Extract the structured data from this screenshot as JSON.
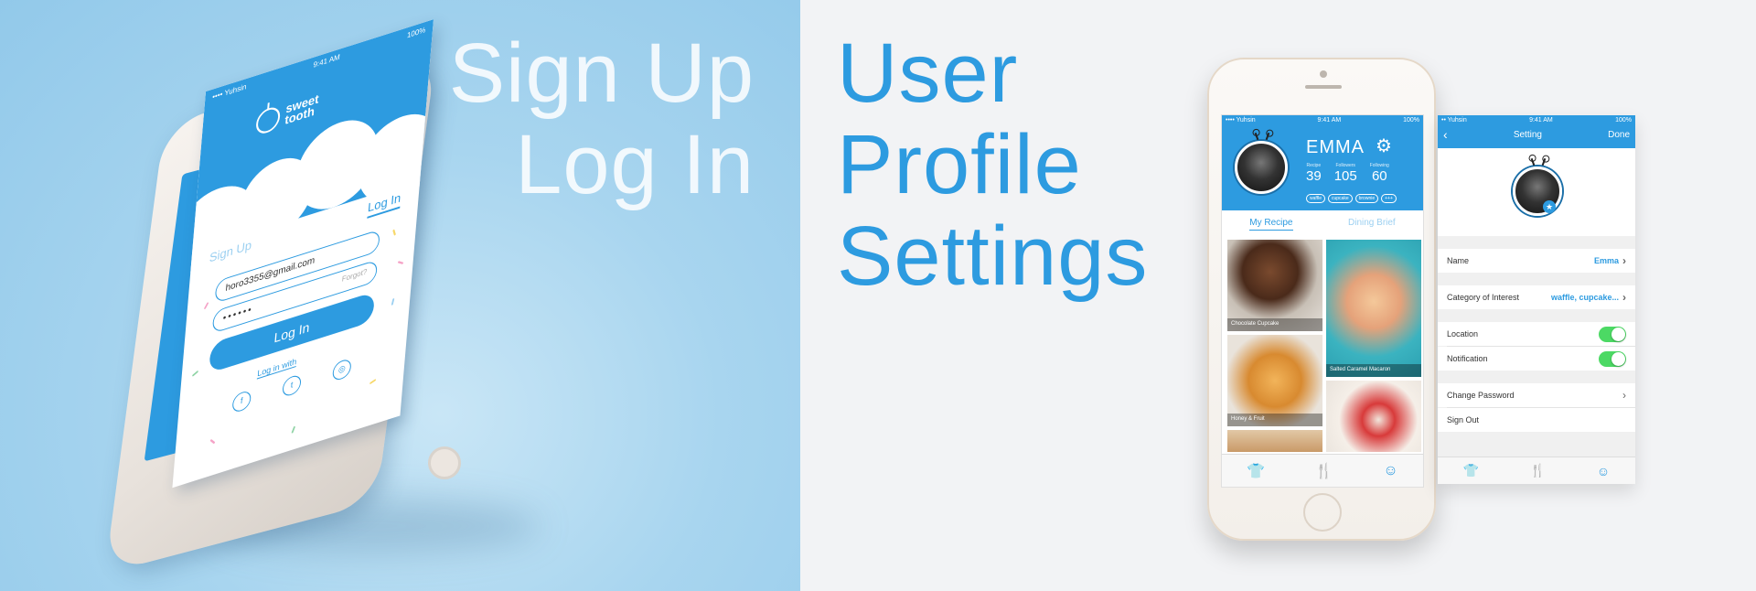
{
  "left_title": [
    "Sign Up",
    "Log In"
  ],
  "right_title": [
    "User",
    "Profile",
    "Settings"
  ],
  "login": {
    "status": {
      "carrier": "•••• Yuhsin",
      "time": "9:41 AM",
      "battery": "100%"
    },
    "logo_text": "sweet tooth",
    "tab_signup": "Sign Up",
    "tab_login": "Log In",
    "email": "horo3355@gmail.com",
    "password": "••••••",
    "forgot": "Forgot?",
    "button": "Log In",
    "login_with": "Log in with",
    "socials": [
      "f",
      "t",
      "◎"
    ]
  },
  "profile": {
    "status": {
      "carrier": "•••• Yuhsin",
      "time": "9:41 AM",
      "battery": "100%"
    },
    "name": "EMMA",
    "stats": [
      {
        "label": "Recipe",
        "value": "39"
      },
      {
        "label": "Followers",
        "value": "105"
      },
      {
        "label": "Following",
        "value": "60"
      }
    ],
    "tags": [
      "waffle",
      "cupcake",
      "brownie",
      "+++"
    ],
    "tabs": [
      "My Recipe",
      "Dining Brief"
    ],
    "tiles": [
      "Chocolate Cupcake",
      "Salted Caramel Macaron",
      "Honey & Fruit",
      "",
      ""
    ],
    "tabbar": [
      "shirt-icon",
      "fork-knife-icon",
      "profile-icon"
    ]
  },
  "settings": {
    "status": {
      "carrier": "•• Yuhsin",
      "time": "9:41 AM",
      "battery": "100%"
    },
    "back": "‹",
    "title": "Setting",
    "done": "Done",
    "rows": {
      "name_label": "Name",
      "name_value": "Emma",
      "category_label": "Category of Interest",
      "category_value": "waffle, cupcake...",
      "location_label": "Location",
      "notification_label": "Notification",
      "change_password_label": "Change Password",
      "sign_out_label": "Sign Out"
    }
  },
  "colors": {
    "brand_blue": "#2d9be0",
    "toggle_green": "#4cd964",
    "left_bg": "#a8d5ef",
    "right_bg": "#f2f3f5"
  }
}
